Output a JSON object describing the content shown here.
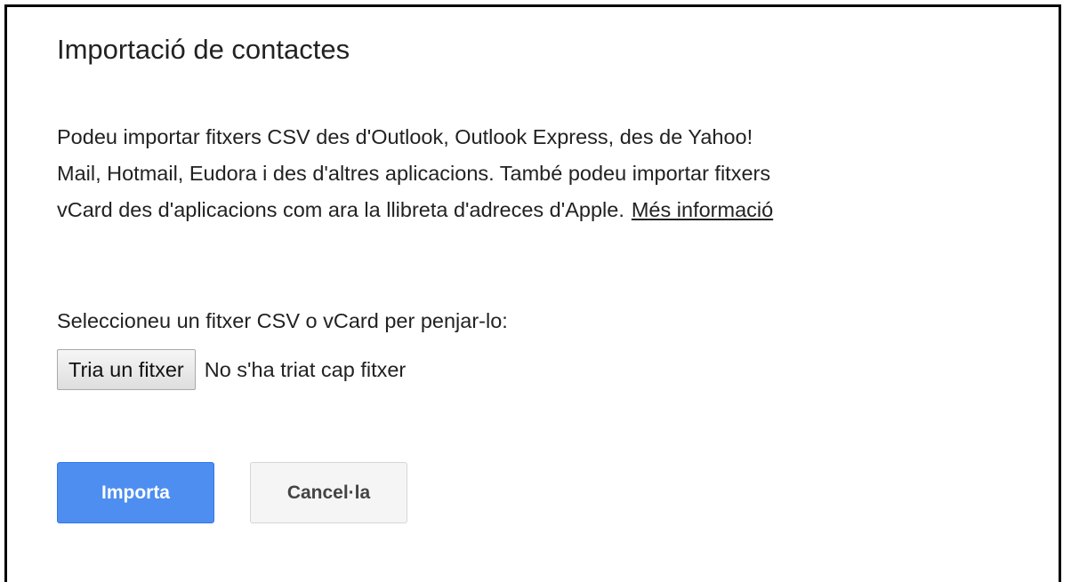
{
  "dialog": {
    "title": "Importació de contactes",
    "description": {
      "line1": "Podeu importar fitxers CSV des d'Outlook, Outlook Express, des de Yahoo!",
      "line2": "Mail, Hotmail, Eudora i des d'altres aplicacions. També podeu importar fitxers",
      "line3": "vCard des d'aplicacions com ara la llibreta d'adreces d'Apple.",
      "more_link": "Més informació"
    },
    "file_select": {
      "label": "Seleccioneu un fitxer CSV o vCard per penjar-lo:",
      "button_label": "Tria un fitxer",
      "status": "No s'ha triat cap fitxer"
    },
    "actions": {
      "import_label": "Importa",
      "cancel_label": "Cancel·la"
    }
  },
  "colors": {
    "primary_button": "#4d8ef0",
    "secondary_button": "#f5f5f5",
    "text": "#222222",
    "border": "#000000"
  }
}
